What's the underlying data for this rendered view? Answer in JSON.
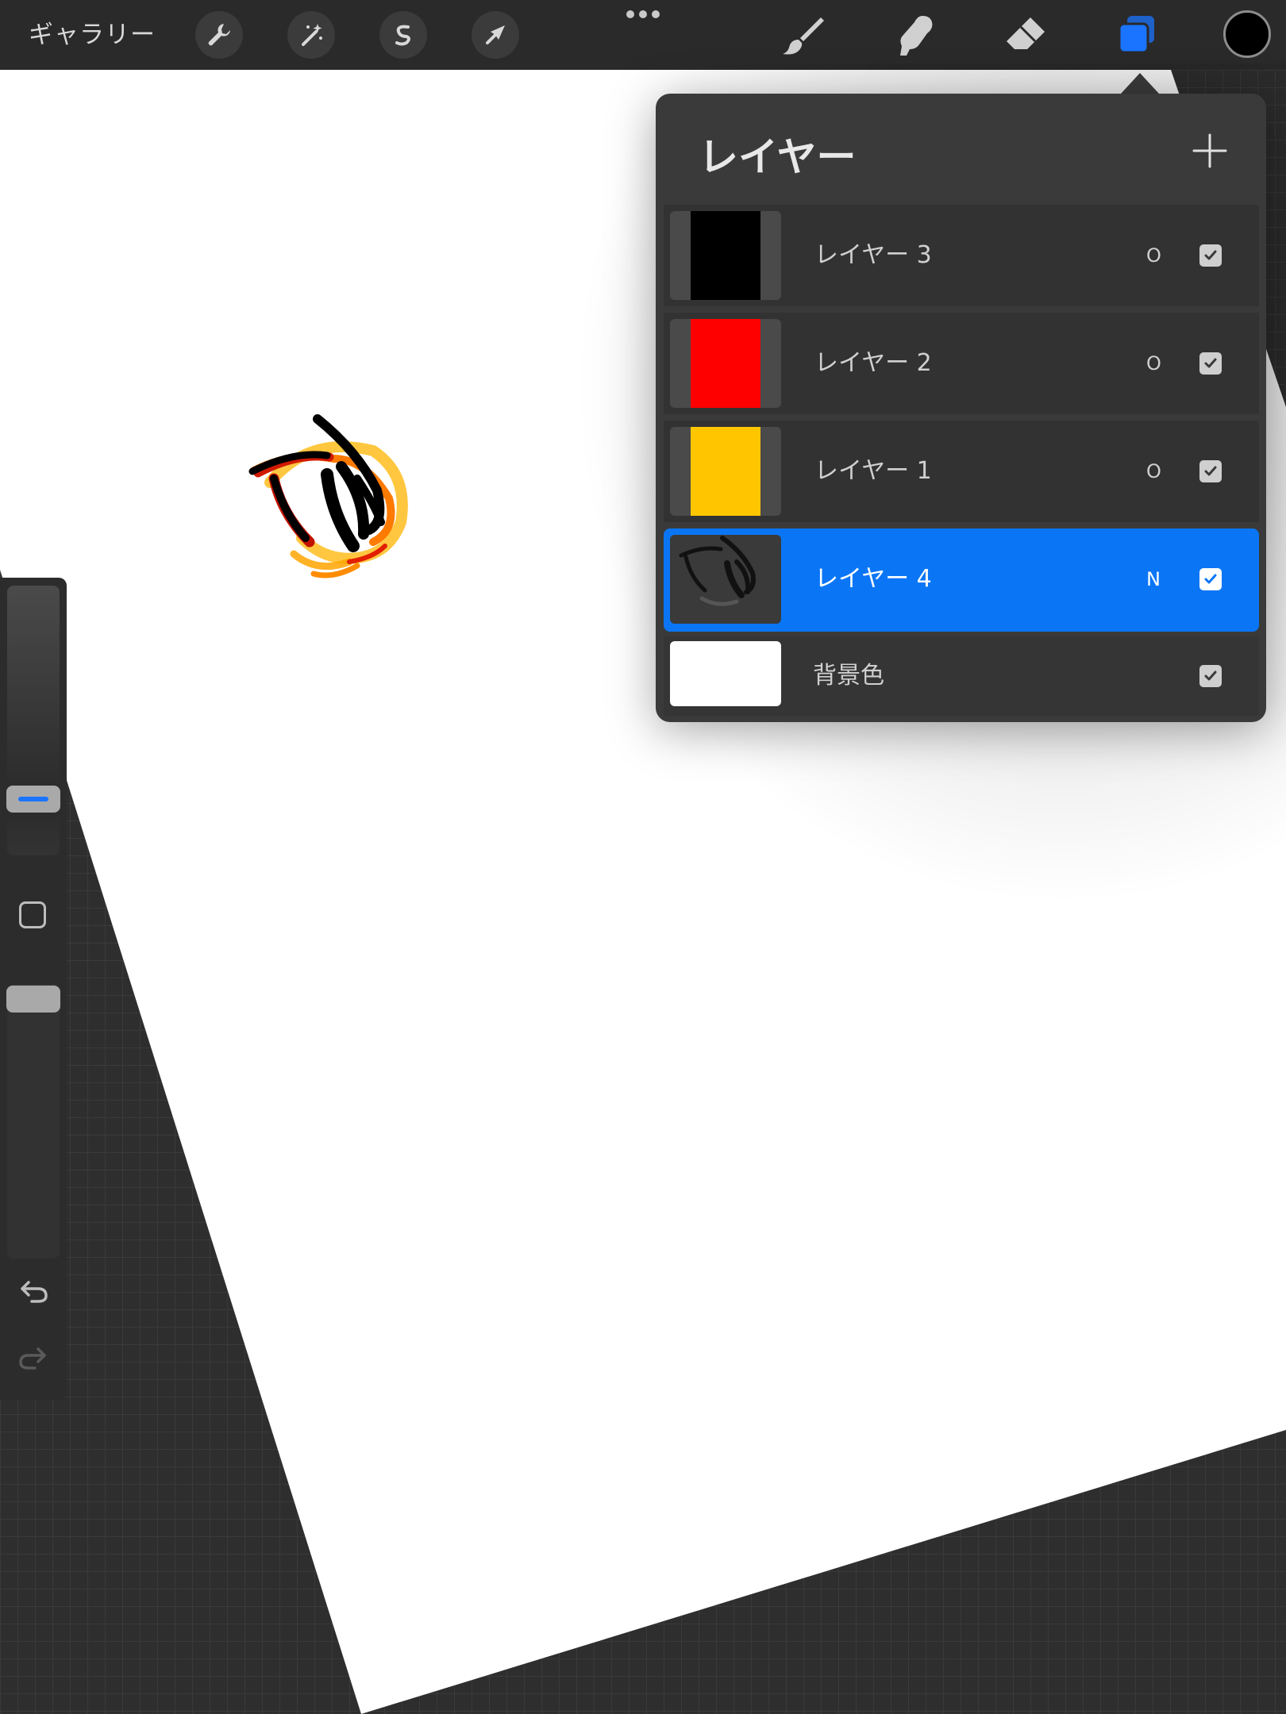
{
  "toolbar": {
    "gallery_label": "ギャラリー",
    "accent_color": "#1a74ff",
    "current_color": "#000000"
  },
  "layers_panel": {
    "title": "レイヤー",
    "layers": [
      {
        "name": "レイヤー 3",
        "blend_mode": "O",
        "visible": true,
        "thumb_color": "#000000",
        "active": false
      },
      {
        "name": "レイヤー 2",
        "blend_mode": "O",
        "visible": true,
        "thumb_color": "#ff0000",
        "active": false
      },
      {
        "name": "レイヤー 1",
        "blend_mode": "O",
        "visible": true,
        "thumb_color": "#ffc600",
        "active": false
      },
      {
        "name": "レイヤー 4",
        "blend_mode": "N",
        "visible": true,
        "thumb_color": "#3a3a3a",
        "active": true
      }
    ],
    "background_layer": {
      "name": "背景色",
      "visible": true,
      "color": "#ffffff"
    }
  }
}
